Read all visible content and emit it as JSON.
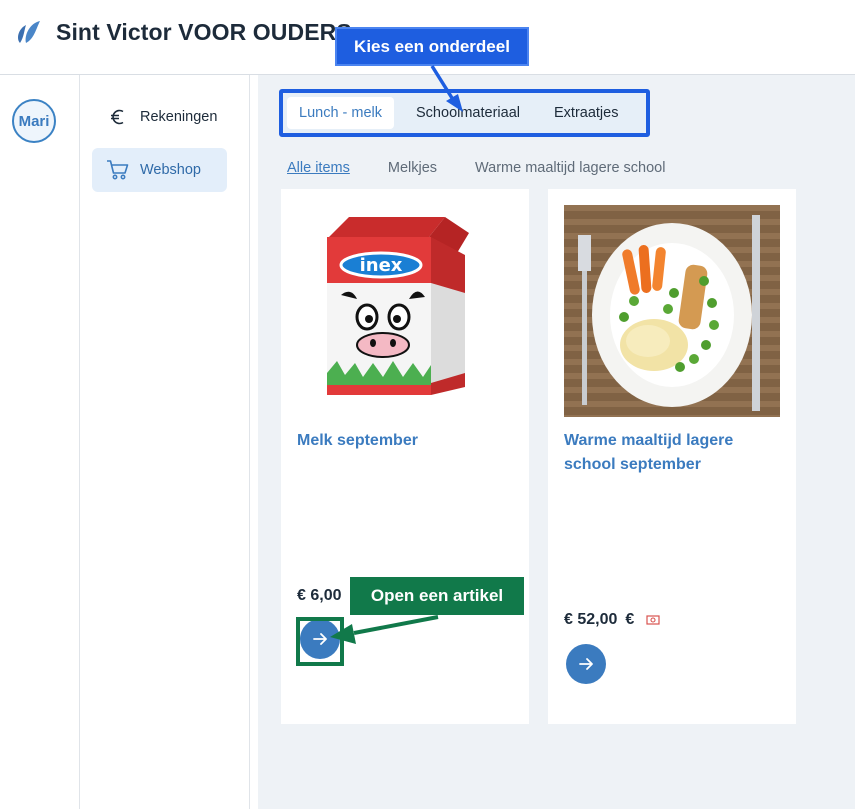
{
  "header": {
    "title": "Sint Victor VOOR OUDERS"
  },
  "rail": {
    "avatar_initials": "Mari"
  },
  "nav": {
    "items": [
      {
        "label": "Rekeningen",
        "icon": "euro-icon"
      },
      {
        "label": "Webshop",
        "icon": "cart-icon",
        "active": true
      }
    ]
  },
  "tabs": [
    {
      "label": "Lunch - melk",
      "active": true
    },
    {
      "label": "Schoolmateriaal"
    },
    {
      "label": "Extraatjes"
    }
  ],
  "filters": [
    {
      "label": "Alle items",
      "active": true
    },
    {
      "label": "Melkjes"
    },
    {
      "label": "Warme maaltijd lagere school"
    }
  ],
  "products": [
    {
      "title": "Melk september",
      "price": "€ 6,00",
      "image": "milk-carton-image"
    },
    {
      "title": "Warme maaltijd lagere school september",
      "price": "€ 52,00",
      "currency_symbol": "€",
      "image": "plate-meal-image",
      "extra_icon": "cash-icon"
    }
  ],
  "annotations": {
    "tabs_callout": "Kies een onderdeel",
    "button_callout": "Open een artikel"
  },
  "colors": {
    "accent": "#3b7bbf",
    "callout_blue": "#1e5ee0",
    "callout_green": "#11794a",
    "main_bg": "#eef2f6"
  }
}
